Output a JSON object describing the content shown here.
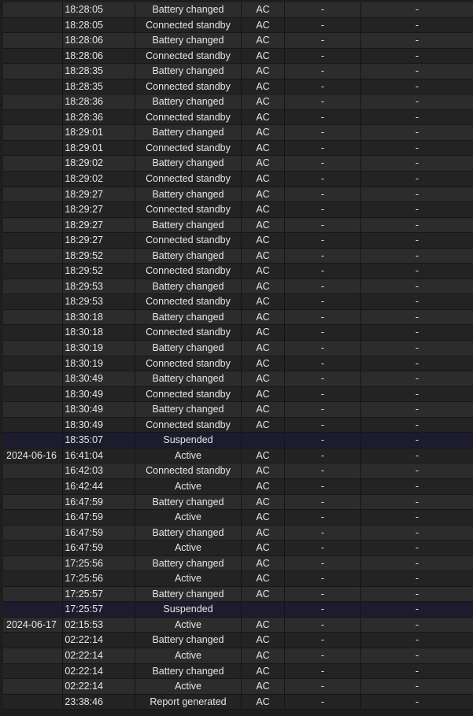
{
  "rows": [
    {
      "date": "",
      "time": "18:28:05",
      "state": "Battery changed",
      "source": "AC",
      "c1": "-",
      "c2": "-"
    },
    {
      "date": "",
      "time": "18:28:05",
      "state": "Connected standby",
      "source": "AC",
      "c1": "-",
      "c2": "-"
    },
    {
      "date": "",
      "time": "18:28:06",
      "state": "Battery changed",
      "source": "AC",
      "c1": "-",
      "c2": "-"
    },
    {
      "date": "",
      "time": "18:28:06",
      "state": "Connected standby",
      "source": "AC",
      "c1": "-",
      "c2": "-"
    },
    {
      "date": "",
      "time": "18:28:35",
      "state": "Battery changed",
      "source": "AC",
      "c1": "-",
      "c2": "-"
    },
    {
      "date": "",
      "time": "18:28:35",
      "state": "Connected standby",
      "source": "AC",
      "c1": "-",
      "c2": "-"
    },
    {
      "date": "",
      "time": "18:28:36",
      "state": "Battery changed",
      "source": "AC",
      "c1": "-",
      "c2": "-"
    },
    {
      "date": "",
      "time": "18:28:36",
      "state": "Connected standby",
      "source": "AC",
      "c1": "-",
      "c2": "-"
    },
    {
      "date": "",
      "time": "18:29:01",
      "state": "Battery changed",
      "source": "AC",
      "c1": "-",
      "c2": "-"
    },
    {
      "date": "",
      "time": "18:29:01",
      "state": "Connected standby",
      "source": "AC",
      "c1": "-",
      "c2": "-"
    },
    {
      "date": "",
      "time": "18:29:02",
      "state": "Battery changed",
      "source": "AC",
      "c1": "-",
      "c2": "-"
    },
    {
      "date": "",
      "time": "18:29:02",
      "state": "Connected standby",
      "source": "AC",
      "c1": "-",
      "c2": "-"
    },
    {
      "date": "",
      "time": "18:29:27",
      "state": "Battery changed",
      "source": "AC",
      "c1": "-",
      "c2": "-"
    },
    {
      "date": "",
      "time": "18:29:27",
      "state": "Connected standby",
      "source": "AC",
      "c1": "-",
      "c2": "-"
    },
    {
      "date": "",
      "time": "18:29:27",
      "state": "Battery changed",
      "source": "AC",
      "c1": "-",
      "c2": "-"
    },
    {
      "date": "",
      "time": "18:29:27",
      "state": "Connected standby",
      "source": "AC",
      "c1": "-",
      "c2": "-"
    },
    {
      "date": "",
      "time": "18:29:52",
      "state": "Battery changed",
      "source": "AC",
      "c1": "-",
      "c2": "-"
    },
    {
      "date": "",
      "time": "18:29:52",
      "state": "Connected standby",
      "source": "AC",
      "c1": "-",
      "c2": "-"
    },
    {
      "date": "",
      "time": "18:29:53",
      "state": "Battery changed",
      "source": "AC",
      "c1": "-",
      "c2": "-"
    },
    {
      "date": "",
      "time": "18:29:53",
      "state": "Connected standby",
      "source": "AC",
      "c1": "-",
      "c2": "-"
    },
    {
      "date": "",
      "time": "18:30:18",
      "state": "Battery changed",
      "source": "AC",
      "c1": "-",
      "c2": "-"
    },
    {
      "date": "",
      "time": "18:30:18",
      "state": "Connected standby",
      "source": "AC",
      "c1": "-",
      "c2": "-"
    },
    {
      "date": "",
      "time": "18:30:19",
      "state": "Battery changed",
      "source": "AC",
      "c1": "-",
      "c2": "-"
    },
    {
      "date": "",
      "time": "18:30:19",
      "state": "Connected standby",
      "source": "AC",
      "c1": "-",
      "c2": "-"
    },
    {
      "date": "",
      "time": "18:30:49",
      "state": "Battery changed",
      "source": "AC",
      "c1": "-",
      "c2": "-"
    },
    {
      "date": "",
      "time": "18:30:49",
      "state": "Connected standby",
      "source": "AC",
      "c1": "-",
      "c2": "-"
    },
    {
      "date": "",
      "time": "18:30:49",
      "state": "Battery changed",
      "source": "AC",
      "c1": "-",
      "c2": "-"
    },
    {
      "date": "",
      "time": "18:30:49",
      "state": "Connected standby",
      "source": "AC",
      "c1": "-",
      "c2": "-"
    },
    {
      "date": "",
      "time": "18:35:07",
      "state": "Suspended",
      "source": "",
      "c1": "-",
      "c2": "-",
      "suspended": true
    },
    {
      "date": "2024-06-16",
      "time": "16:41:04",
      "state": "Active",
      "source": "AC",
      "c1": "-",
      "c2": "-"
    },
    {
      "date": "",
      "time": "16:42:03",
      "state": "Connected standby",
      "source": "AC",
      "c1": "-",
      "c2": "-"
    },
    {
      "date": "",
      "time": "16:42:44",
      "state": "Active",
      "source": "AC",
      "c1": "-",
      "c2": "-"
    },
    {
      "date": "",
      "time": "16:47:59",
      "state": "Battery changed",
      "source": "AC",
      "c1": "-",
      "c2": "-"
    },
    {
      "date": "",
      "time": "16:47:59",
      "state": "Active",
      "source": "AC",
      "c1": "-",
      "c2": "-"
    },
    {
      "date": "",
      "time": "16:47:59",
      "state": "Battery changed",
      "source": "AC",
      "c1": "-",
      "c2": "-"
    },
    {
      "date": "",
      "time": "16:47:59",
      "state": "Active",
      "source": "AC",
      "c1": "-",
      "c2": "-"
    },
    {
      "date": "",
      "time": "17:25:56",
      "state": "Battery changed",
      "source": "AC",
      "c1": "-",
      "c2": "-"
    },
    {
      "date": "",
      "time": "17:25:56",
      "state": "Active",
      "source": "AC",
      "c1": "-",
      "c2": "-"
    },
    {
      "date": "",
      "time": "17:25:57",
      "state": "Battery changed",
      "source": "AC",
      "c1": "-",
      "c2": "-"
    },
    {
      "date": "",
      "time": "17:25:57",
      "state": "Suspended",
      "source": "",
      "c1": "-",
      "c2": "-",
      "suspended": true
    },
    {
      "date": "2024-06-17",
      "time": "02:15:53",
      "state": "Active",
      "source": "AC",
      "c1": "-",
      "c2": "-"
    },
    {
      "date": "",
      "time": "02:22:14",
      "state": "Battery changed",
      "source": "AC",
      "c1": "-",
      "c2": "-"
    },
    {
      "date": "",
      "time": "02:22:14",
      "state": "Active",
      "source": "AC",
      "c1": "-",
      "c2": "-"
    },
    {
      "date": "",
      "time": "02:22:14",
      "state": "Battery changed",
      "source": "AC",
      "c1": "-",
      "c2": "-"
    },
    {
      "date": "",
      "time": "02:22:14",
      "state": "Active",
      "source": "AC",
      "c1": "-",
      "c2": "-"
    },
    {
      "date": "",
      "time": "23:38:46",
      "state": "Report generated",
      "source": "AC",
      "c1": "-",
      "c2": "-"
    }
  ],
  "colors": {
    "row_odd": "#2c2c2c",
    "row_even": "#232323",
    "row_suspended": "#1c1c2e",
    "text": "#e6e6e6"
  }
}
